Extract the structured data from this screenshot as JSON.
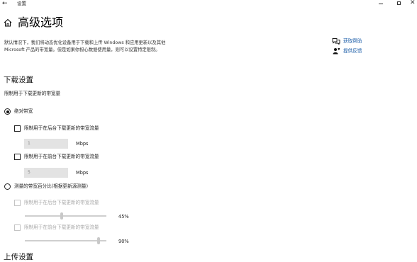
{
  "window": {
    "back_glyph": "←",
    "title": "设置",
    "close_glyph": "✕"
  },
  "page": {
    "title": "高级选项",
    "intro": "默认情况下，我们将动态优化设备用于下载和上传 Windows 和应用更新以及其他 Microsoft 产品的带宽量。但是如果你担心数据使用量，则可以设置特定限制。"
  },
  "help": {
    "get_help": "获取帮助",
    "feedback": "提供反馈"
  },
  "download": {
    "section_title": "下载设置",
    "limit_label": "限制用于下载更新的带宽量",
    "absolute": {
      "label": "绝对带宽",
      "selected": true,
      "background_label": "限制用于在后台下载更新的带宽流量",
      "background_value": "1",
      "background_unit": "Mbps",
      "foreground_label": "限制用于在前台下载更新的带宽流量",
      "foreground_value": "5",
      "foreground_unit": "Mbps"
    },
    "percentage": {
      "label": "测量的带宽百分比(根据更新源测量)",
      "selected": false,
      "background_label": "限制用于在后台下载更新的带宽流量",
      "background_percent": 45,
      "background_text": "45%",
      "foreground_label": "限制用于在前台下载更新的带宽流量",
      "foreground_percent": 90,
      "foreground_text": "90%"
    }
  },
  "upload": {
    "section_title": "上传设置"
  },
  "icons": {
    "home": "home-icon",
    "help": "chat-help-icon",
    "feedback": "feedback-person-icon"
  }
}
